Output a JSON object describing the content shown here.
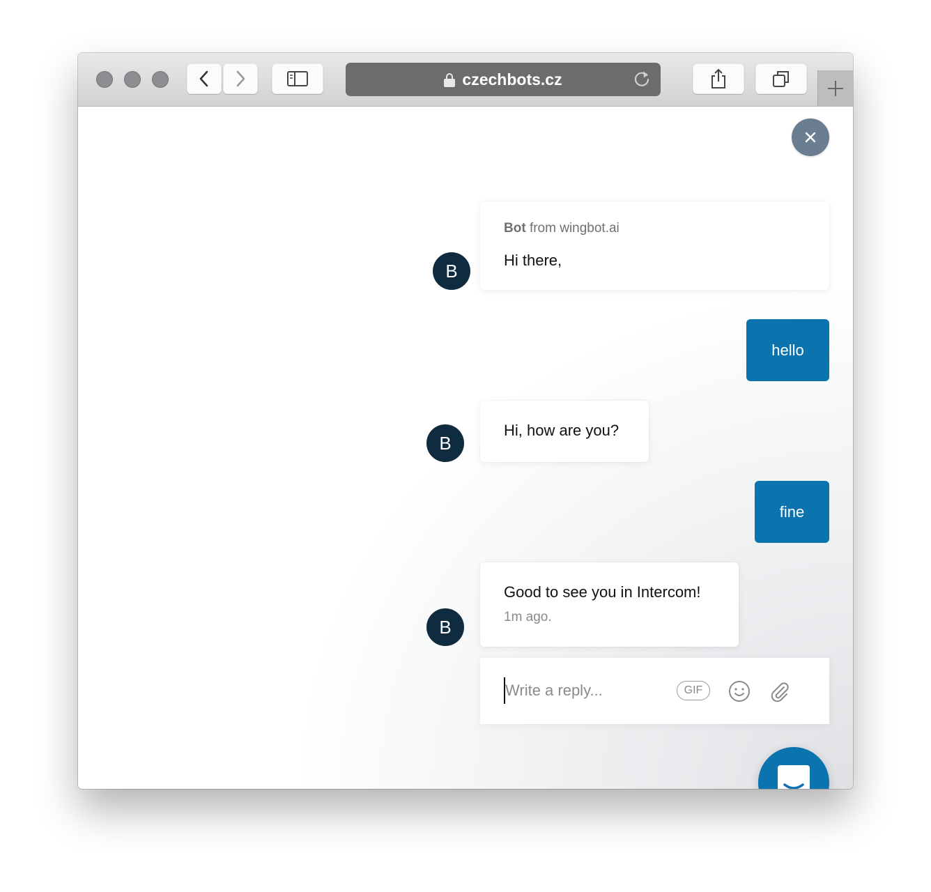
{
  "browser": {
    "url": "czechbots.cz"
  },
  "chat": {
    "messages": [
      {
        "from": "bot",
        "sender_name": "Bot",
        "sender_suffix": "from wingbot.ai",
        "avatar_letter": "B",
        "text": "Hi there,"
      },
      {
        "from": "user",
        "text": "hello"
      },
      {
        "from": "bot",
        "avatar_letter": "B",
        "text": "Hi, how are you?"
      },
      {
        "from": "user",
        "text": "fine"
      },
      {
        "from": "bot",
        "avatar_letter": "B",
        "text": "Good to see you in Intercom!",
        "time": "1m ago."
      }
    ],
    "composer": {
      "placeholder": "Write a reply...",
      "value": "",
      "gif_label": "GIF"
    },
    "close_icon": "close-icon",
    "launcher_icon": "intercom-chat-icon"
  },
  "colors": {
    "accent": "#0b73ae",
    "avatar": "#0e2b3f",
    "close_button": "#6b7d90"
  }
}
